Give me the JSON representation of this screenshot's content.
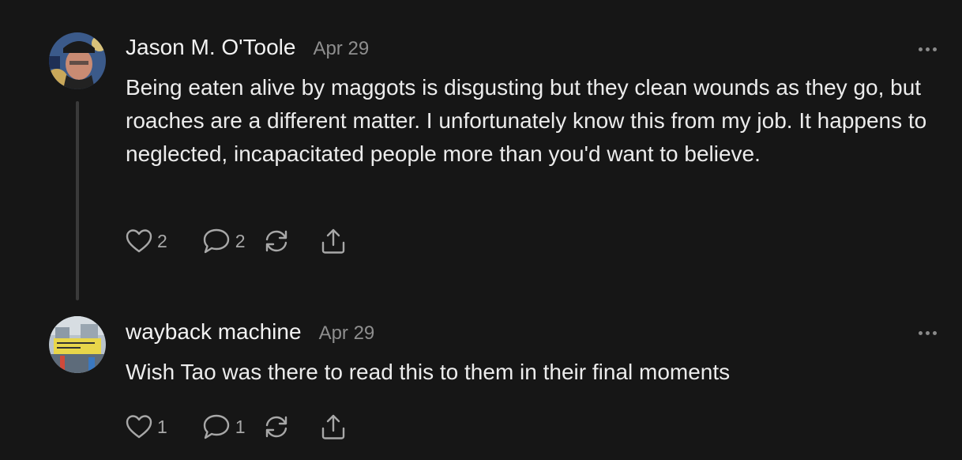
{
  "comments": [
    {
      "author": "Jason M. O'Toole",
      "date": "Apr 29",
      "text": "Being eaten alive by maggots is disgusting but they clean wounds as they go, but roaches are a different matter. I unfortunately know this from my job. It happens to neglected, incapacitated people more than you'd want to believe.",
      "likes": "2",
      "replies": "2"
    },
    {
      "author": "wayback machine",
      "date": "Apr 29",
      "text": "Wish Tao was there to read this to them in their final moments",
      "likes": "1",
      "replies": "1"
    }
  ],
  "icons": {
    "like": "heart-icon",
    "reply": "speech-bubble-icon",
    "restack": "restack-arrows-icon",
    "share": "share-upload-icon",
    "more": "ellipsis-icon"
  },
  "colors": {
    "background": "#161616",
    "text": "#ececec",
    "muted": "#8e8e8e",
    "icon": "#a8a8a8",
    "thread_line": "#3a3a3a"
  }
}
